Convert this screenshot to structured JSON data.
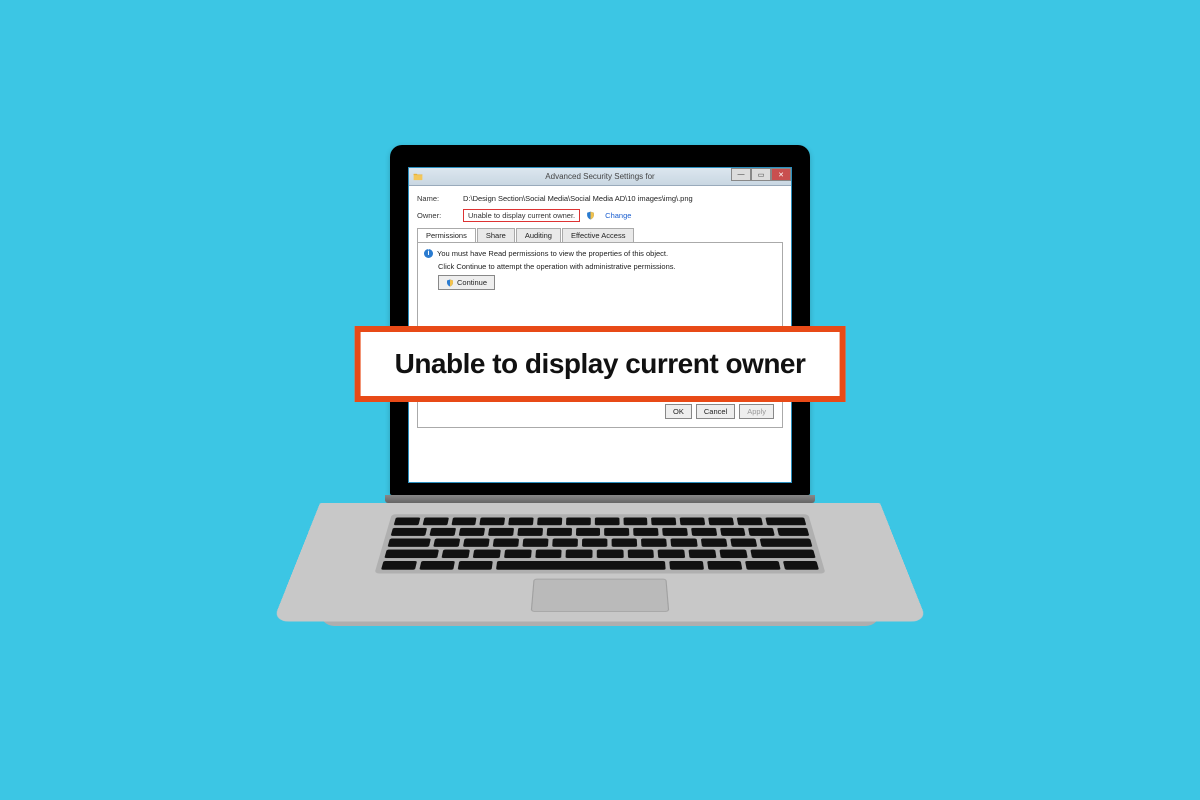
{
  "banner": {
    "text": "Unable to display current owner"
  },
  "window": {
    "title": "Advanced Security Settings for",
    "name_label": "Name:",
    "name_value": "D:\\Design Section\\Social Media\\Social Media AD\\10 images\\img\\.png",
    "owner_label": "Owner:",
    "owner_value": "Unable to display current owner.",
    "change_label": "Change",
    "tabs": [
      "Permissions",
      "Share",
      "Auditing",
      "Effective Access"
    ],
    "info_text": "You must have Read permissions to view the properties of this object.",
    "continue_text": "Click Continue to attempt the operation with administrative permissions.",
    "continue_btn": "Continue",
    "ok": "OK",
    "cancel": "Cancel",
    "apply": "Apply"
  }
}
